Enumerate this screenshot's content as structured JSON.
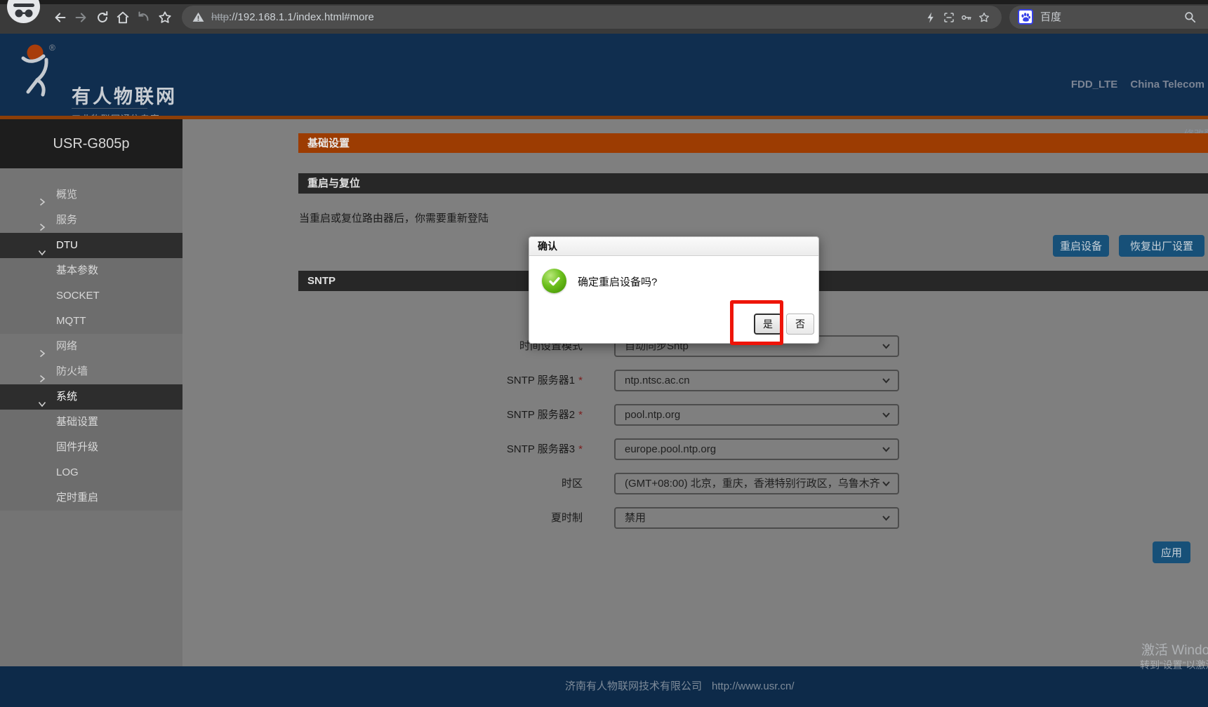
{
  "browser": {
    "url_scheme": "http",
    "url_rest": "://192.168.1.1/index.html#more",
    "search_engine_label": "百度",
    "icons": [
      "incognito-avatar",
      "back",
      "forward",
      "reload",
      "home",
      "history-back",
      "bookmark-star",
      "site-warning",
      "lightning",
      "screenshot-scan",
      "key",
      "star",
      "baidu-logo",
      "search-magnifier"
    ]
  },
  "header": {
    "brand_title": "有人物联网",
    "brand_subtitle": "工业物联网通信专家",
    "registered_mark": "®",
    "network_type": "FDD_LTE",
    "carrier": "China Telecom",
    "change_password_link": "修改登录密码"
  },
  "sidebar": {
    "device_model": "USR-G805p",
    "items": [
      {
        "label": "概览",
        "kind": "parent",
        "state": "collapsed"
      },
      {
        "label": "服务",
        "kind": "parent",
        "state": "collapsed"
      },
      {
        "label": "DTU",
        "kind": "parent",
        "state": "expanded"
      },
      {
        "label": "基本参数",
        "kind": "child"
      },
      {
        "label": "SOCKET",
        "kind": "child"
      },
      {
        "label": "MQTT",
        "kind": "child"
      },
      {
        "label": "网络",
        "kind": "parent",
        "state": "collapsed"
      },
      {
        "label": "防火墙",
        "kind": "parent",
        "state": "collapsed"
      },
      {
        "label": "系统",
        "kind": "parent",
        "state": "expanded"
      },
      {
        "label": "基础设置",
        "kind": "child"
      },
      {
        "label": "固件升级",
        "kind": "child"
      },
      {
        "label": "LOG",
        "kind": "child"
      },
      {
        "label": "定时重启",
        "kind": "child"
      }
    ]
  },
  "main": {
    "page_title": "基础设置",
    "restart": {
      "title": "重启与复位",
      "description": "当重启或复位路由器后，你需要重新登陆",
      "restart_button": "重启设备",
      "factory_reset_button": "恢复出厂设置"
    },
    "sntp": {
      "title": "SNTP",
      "required_marker": "*",
      "fields": [
        {
          "label": "时间设置模式",
          "required": false,
          "value": "自动同步Sntp"
        },
        {
          "label": "SNTP 服务器1",
          "required": true,
          "value": "ntp.ntsc.ac.cn"
        },
        {
          "label": "SNTP 服务器2",
          "required": true,
          "value": "pool.ntp.org"
        },
        {
          "label": "SNTP 服务器3",
          "required": true,
          "value": "europe.pool.ntp.org"
        },
        {
          "label": "时区",
          "required": false,
          "value": "(GMT+08:00) 北京，重庆，香港特别行政区，乌鲁木齐"
        },
        {
          "label": "夏时制",
          "required": false,
          "value": "禁用"
        }
      ],
      "apply_button": "应用"
    }
  },
  "dialog": {
    "title": "确认",
    "message": "确定重启设备吗?",
    "yes_button": "是",
    "no_button": "否",
    "icon": "green-check"
  },
  "footer": {
    "company": "济南有人物联网技术有限公司",
    "website": "http://www.usr.cn/"
  },
  "watermark": {
    "line1": "激活 Windows",
    "line2": "转到“设置”以激活 Windows。"
  },
  "colors": {
    "accent_orange": "#9c3c02",
    "header_navy": "#102e4f",
    "button_blue": "#175078",
    "annotation_red": "#ee1408",
    "success_green": "#58a40c"
  }
}
